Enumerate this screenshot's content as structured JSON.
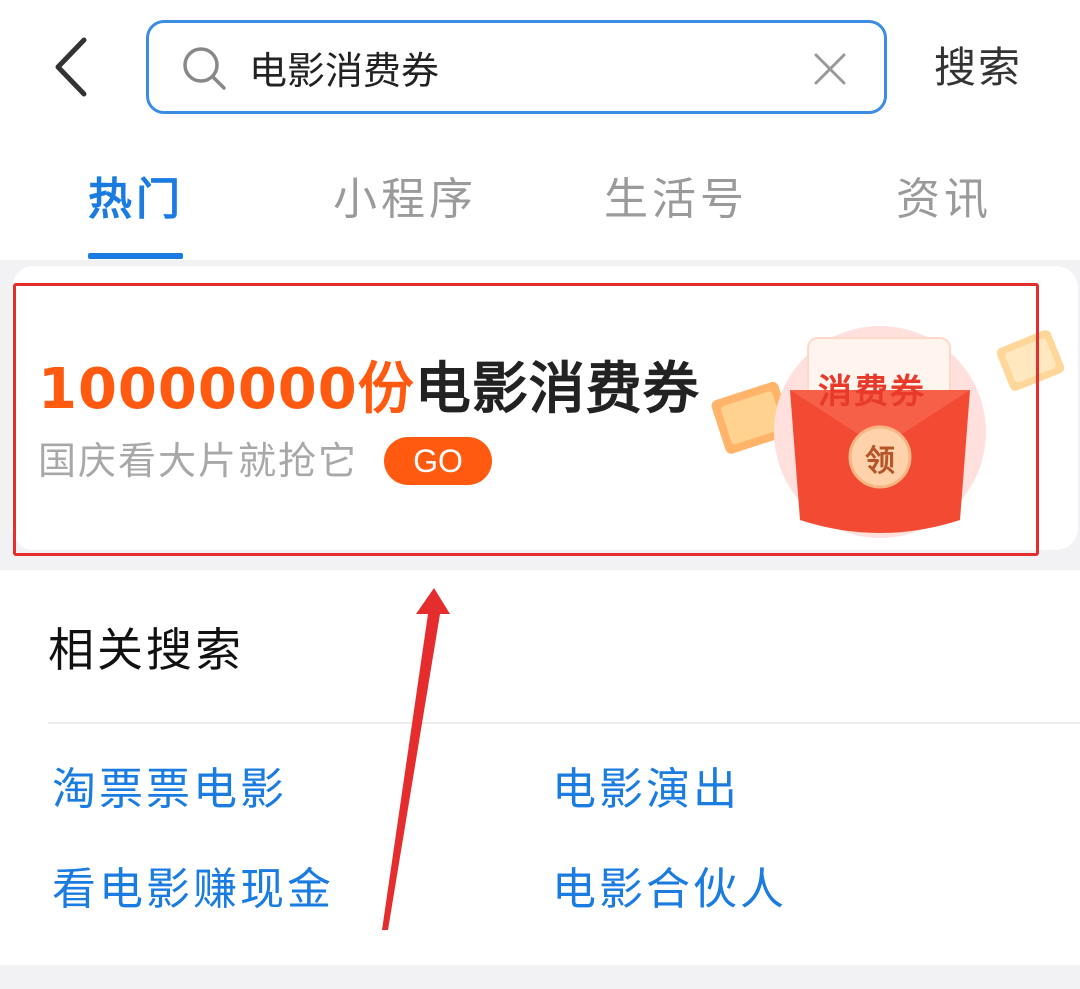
{
  "search": {
    "query": "电影消费券",
    "button_label": "搜索"
  },
  "tabs": [
    {
      "label": "热门",
      "active": true
    },
    {
      "label": "小程序",
      "active": false
    },
    {
      "label": "生活号",
      "active": false
    },
    {
      "label": "资讯",
      "active": false
    }
  ],
  "banner": {
    "count": "10000000份",
    "title": "电影消费券",
    "subtitle": "国庆看大片就抢它",
    "go_label": "GO",
    "coupon_label": "消费券",
    "claim_label": "领"
  },
  "related": {
    "title": "相关搜索",
    "items": [
      "淘票票电影",
      "电影演出",
      "看电影赚现金",
      "电影合伙人"
    ]
  },
  "colors": {
    "accent_blue": "#1a7be0",
    "search_border": "#3b8de4",
    "orange": "#ff5a10",
    "annotation_red": "#e52d2d"
  }
}
